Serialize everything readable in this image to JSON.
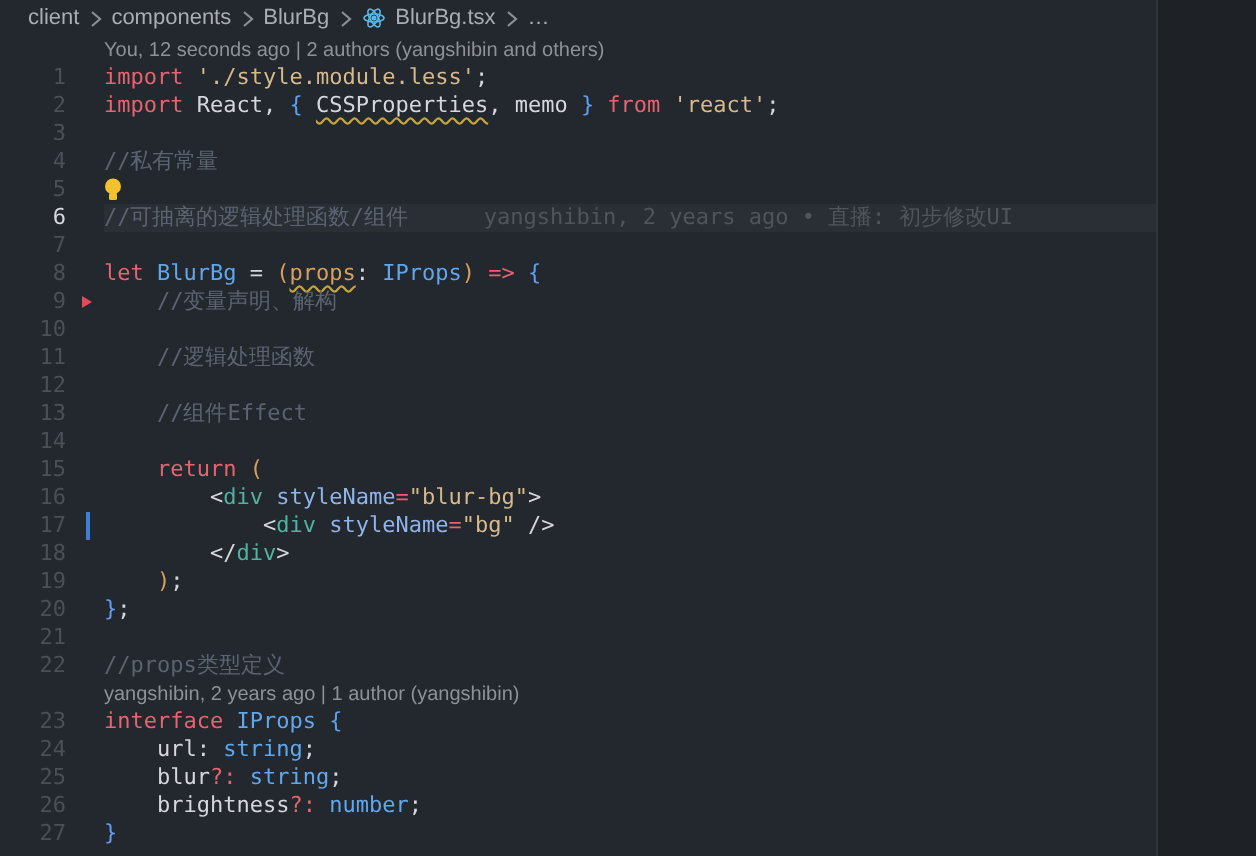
{
  "breadcrumb": [
    {
      "label": "client",
      "kind": "folder"
    },
    {
      "label": "components",
      "kind": "folder"
    },
    {
      "label": "BlurBg",
      "kind": "folder"
    },
    {
      "label": "BlurBg.tsx",
      "kind": "file"
    },
    {
      "label": "…",
      "kind": "more"
    }
  ],
  "rows": [
    {
      "kind": "lens",
      "text": "You, 12 seconds ago | 2 authors (yangshibin and others)"
    },
    {
      "kind": "code",
      "number": "1",
      "current": false,
      "tokens": [
        {
          "text": "import",
          "kind": "keyword"
        },
        {
          "text": " './style.module.less'",
          "kind": "string"
        },
        {
          "text": ";",
          "kind": "plain"
        }
      ]
    },
    {
      "kind": "code",
      "number": "2",
      "current": false,
      "tokens": [
        {
          "text": "import",
          "kind": "keyword"
        },
        {
          "text": " React, ",
          "kind": "plain"
        },
        {
          "text": "{ ",
          "kind": "brace"
        },
        {
          "text": "CSSProperties",
          "kind": "plain",
          "warning": true
        },
        {
          "text": ", memo ",
          "kind": "plain"
        },
        {
          "text": "}",
          "kind": "brace"
        },
        {
          "text": " from",
          "kind": "keyword"
        },
        {
          "text": " 'react'",
          "kind": "string"
        },
        {
          "text": ";",
          "kind": "plain"
        }
      ]
    },
    {
      "kind": "code",
      "number": "3",
      "current": false,
      "tokens": []
    },
    {
      "kind": "code",
      "number": "4",
      "current": false,
      "tokens": [
        {
          "text": "//私有常量",
          "kind": "comment"
        }
      ]
    },
    {
      "kind": "code",
      "number": "5",
      "current": false,
      "decoration": {
        "kind": "lightbulb"
      },
      "tokens": []
    },
    {
      "kind": "code",
      "number": "6",
      "current": true,
      "blame": "yangshibin, 2 years ago • 直播: 初步修改UI",
      "tokens": [
        {
          "text": "//可抽离的逻辑处理函数/组件",
          "kind": "comment"
        }
      ]
    },
    {
      "kind": "code",
      "number": "7",
      "current": false,
      "tokens": []
    },
    {
      "kind": "code",
      "number": "8",
      "current": false,
      "tokens": [
        {
          "text": "let",
          "kind": "keyword"
        },
        {
          "text": " BlurBg",
          "kind": "type"
        },
        {
          "text": " = ",
          "kind": "plain"
        },
        {
          "text": "(",
          "kind": "paren"
        },
        {
          "text": "props",
          "kind": "param",
          "warning": true
        },
        {
          "text": ": ",
          "kind": "plain"
        },
        {
          "text": "IProps",
          "kind": "type"
        },
        {
          "text": ")",
          "kind": "paren"
        },
        {
          "text": " =>",
          "kind": "keyword"
        },
        {
          "text": " {",
          "kind": "brace"
        }
      ]
    },
    {
      "kind": "code",
      "number": "9",
      "current": false,
      "decoration": {
        "kind": "deleted"
      },
      "tokens": [
        {
          "text": "    //变量声明、解构",
          "kind": "comment"
        }
      ]
    },
    {
      "kind": "code",
      "number": "10",
      "current": false,
      "tokens": []
    },
    {
      "kind": "code",
      "number": "11",
      "current": false,
      "tokens": [
        {
          "text": "    //逻辑处理函数",
          "kind": "comment"
        }
      ]
    },
    {
      "kind": "code",
      "number": "12",
      "current": false,
      "tokens": []
    },
    {
      "kind": "code",
      "number": "13",
      "current": false,
      "tokens": [
        {
          "text": "    //组件Effect",
          "kind": "comment"
        }
      ]
    },
    {
      "kind": "code",
      "number": "14",
      "current": false,
      "tokens": []
    },
    {
      "kind": "code",
      "number": "15",
      "current": false,
      "tokens": [
        {
          "text": "    return",
          "kind": "keyword"
        },
        {
          "text": " (",
          "kind": "paren"
        }
      ]
    },
    {
      "kind": "code",
      "number": "16",
      "current": false,
      "tokens": [
        {
          "text": "        <",
          "kind": "plain"
        },
        {
          "text": "div",
          "kind": "tag"
        },
        {
          "text": " styleName",
          "kind": "attr"
        },
        {
          "text": "=",
          "kind": "keyword"
        },
        {
          "text": "\"blur-bg\"",
          "kind": "string"
        },
        {
          "text": ">",
          "kind": "plain"
        }
      ]
    },
    {
      "kind": "code",
      "number": "17",
      "current": false,
      "decoration": {
        "kind": "modified"
      },
      "tokens": [
        {
          "text": "            <",
          "kind": "plain"
        },
        {
          "text": "div",
          "kind": "tag"
        },
        {
          "text": " styleName",
          "kind": "attr"
        },
        {
          "text": "=",
          "kind": "keyword"
        },
        {
          "text": "\"bg\"",
          "kind": "string"
        },
        {
          "text": " />",
          "kind": "plain"
        }
      ]
    },
    {
      "kind": "code",
      "number": "18",
      "current": false,
      "tokens": [
        {
          "text": "        </",
          "kind": "plain"
        },
        {
          "text": "div",
          "kind": "tag"
        },
        {
          "text": ">",
          "kind": "plain"
        }
      ]
    },
    {
      "kind": "code",
      "number": "19",
      "current": false,
      "tokens": [
        {
          "text": "    )",
          "kind": "paren"
        },
        {
          "text": ";",
          "kind": "plain"
        }
      ]
    },
    {
      "kind": "code",
      "number": "20",
      "current": false,
      "tokens": [
        {
          "text": "}",
          "kind": "brace"
        },
        {
          "text": ";",
          "kind": "plain"
        }
      ]
    },
    {
      "kind": "code",
      "number": "21",
      "current": false,
      "tokens": []
    },
    {
      "kind": "code",
      "number": "22",
      "current": false,
      "tokens": [
        {
          "text": "//props类型定义",
          "kind": "comment"
        }
      ]
    },
    {
      "kind": "lens",
      "text": "yangshibin, 2 years ago | 1 author (yangshibin)"
    },
    {
      "kind": "code",
      "number": "23",
      "current": false,
      "tokens": [
        {
          "text": "interface",
          "kind": "keyword"
        },
        {
          "text": " IProps",
          "kind": "type"
        },
        {
          "text": " {",
          "kind": "brace"
        }
      ]
    },
    {
      "kind": "code",
      "number": "24",
      "current": false,
      "tokens": [
        {
          "text": "    url: ",
          "kind": "plain"
        },
        {
          "text": "string",
          "kind": "type"
        },
        {
          "text": ";",
          "kind": "plain"
        }
      ]
    },
    {
      "kind": "code",
      "number": "25",
      "current": false,
      "tokens": [
        {
          "text": "    blur",
          "kind": "plain"
        },
        {
          "text": "?:",
          "kind": "keyword"
        },
        {
          "text": " string",
          "kind": "type"
        },
        {
          "text": ";",
          "kind": "plain"
        }
      ]
    },
    {
      "kind": "code",
      "number": "26",
      "current": false,
      "tokens": [
        {
          "text": "    brightness",
          "kind": "plain"
        },
        {
          "text": "?:",
          "kind": "keyword"
        },
        {
          "text": " number",
          "kind": "type"
        },
        {
          "text": ";",
          "kind": "plain"
        }
      ]
    },
    {
      "kind": "code",
      "number": "27",
      "current": false,
      "tokens": [
        {
          "text": "}",
          "kind": "brace"
        }
      ]
    }
  ]
}
